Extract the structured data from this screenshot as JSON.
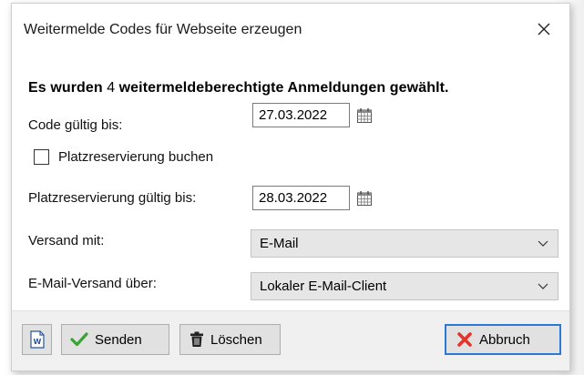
{
  "dialog": {
    "title": "Weitermelde Codes für Webseite erzeugen"
  },
  "headline": {
    "part1": "Es wurden",
    "count": " 4 ",
    "part2": "weitermeldeberechtigte Anmeldungen gewählt."
  },
  "form": {
    "code_valid_label": "Code gültig bis:",
    "code_valid_value": "27.03.2022",
    "reservation_checkbox_label": "Platzreservierung buchen",
    "reservation_checked": false,
    "reservation_valid_label": "Platzreservierung gültig bis:",
    "reservation_valid_value": "28.03.2022",
    "send_with_label": "Versand mit:",
    "send_with_value": "E-Mail",
    "email_via_label": "E-Mail-Versand über:",
    "email_via_value": "Lokaler E-Mail-Client"
  },
  "buttons": {
    "word_icon": "word-document-icon",
    "send_label": "Senden",
    "delete_label": "Löschen",
    "cancel_label": "Abbruch"
  },
  "colors": {
    "checkmark": "#3aa335",
    "cancel_x": "#e5332a",
    "focus_border": "#2d78d7"
  }
}
